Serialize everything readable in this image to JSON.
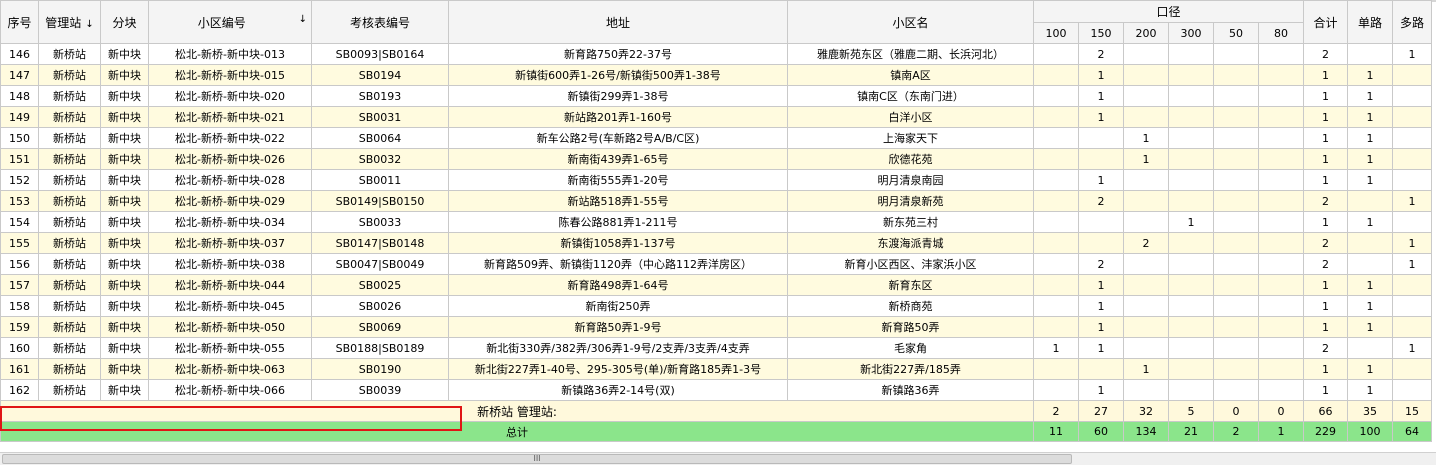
{
  "columns": {
    "seq": "序号",
    "station": "管理站",
    "block": "分块",
    "community_code": "小区编号",
    "meter_code": "考核表编号",
    "address": "地址",
    "community_name": "小区名",
    "diameter": "口径",
    "d100": "100",
    "d150": "150",
    "d200": "200",
    "d300": "300",
    "d50": "50",
    "d80": "80",
    "total": "合计",
    "single": "单路",
    "multi": "多路",
    "sort_desc": "↓"
  },
  "rows": [
    {
      "seq": "146",
      "station": "新桥站",
      "block": "新中块",
      "community_code": "松北-新桥-新中块-013",
      "meter_code": "SB0093|SB0164",
      "address": "新育路750弄22-37号",
      "community_name": "雅鹿新苑东区（雅鹿二期、长浜河北）",
      "d100": "",
      "d150": "2",
      "d200": "",
      "d300": "",
      "d50": "",
      "d80": "",
      "total": "2",
      "single": "",
      "multi": "1"
    },
    {
      "seq": "147",
      "station": "新桥站",
      "block": "新中块",
      "community_code": "松北-新桥-新中块-015",
      "meter_code": "SB0194",
      "address": "新镇街600弄1-26号/新镇街500弄1-38号",
      "community_name": "镇南A区",
      "d100": "",
      "d150": "1",
      "d200": "",
      "d300": "",
      "d50": "",
      "d80": "",
      "total": "1",
      "single": "1",
      "multi": ""
    },
    {
      "seq": "148",
      "station": "新桥站",
      "block": "新中块",
      "community_code": "松北-新桥-新中块-020",
      "meter_code": "SB0193",
      "address": "新镇街299弄1-38号",
      "community_name": "镇南C区（东南门进）",
      "d100": "",
      "d150": "1",
      "d200": "",
      "d300": "",
      "d50": "",
      "d80": "",
      "total": "1",
      "single": "1",
      "multi": ""
    },
    {
      "seq": "149",
      "station": "新桥站",
      "block": "新中块",
      "community_code": "松北-新桥-新中块-021",
      "meter_code": "SB0031",
      "address": "新站路201弄1-160号",
      "community_name": "白洋小区",
      "d100": "",
      "d150": "1",
      "d200": "",
      "d300": "",
      "d50": "",
      "d80": "",
      "total": "1",
      "single": "1",
      "multi": ""
    },
    {
      "seq": "150",
      "station": "新桥站",
      "block": "新中块",
      "community_code": "松北-新桥-新中块-022",
      "meter_code": "SB0064",
      "address": "新车公路2号(车新路2号A/B/C区)",
      "community_name": "上海家天下",
      "d100": "",
      "d150": "",
      "d200": "1",
      "d300": "",
      "d50": "",
      "d80": "",
      "total": "1",
      "single": "1",
      "multi": ""
    },
    {
      "seq": "151",
      "station": "新桥站",
      "block": "新中块",
      "community_code": "松北-新桥-新中块-026",
      "meter_code": "SB0032",
      "address": "新南街439弄1-65号",
      "community_name": "欣德花苑",
      "d100": "",
      "d150": "",
      "d200": "1",
      "d300": "",
      "d50": "",
      "d80": "",
      "total": "1",
      "single": "1",
      "multi": ""
    },
    {
      "seq": "152",
      "station": "新桥站",
      "block": "新中块",
      "community_code": "松北-新桥-新中块-028",
      "meter_code": "SB0011",
      "address": "新南街555弄1-20号",
      "community_name": "明月清泉南园",
      "d100": "",
      "d150": "1",
      "d200": "",
      "d300": "",
      "d50": "",
      "d80": "",
      "total": "1",
      "single": "1",
      "multi": ""
    },
    {
      "seq": "153",
      "station": "新桥站",
      "block": "新中块",
      "community_code": "松北-新桥-新中块-029",
      "meter_code": "SB0149|SB0150",
      "address": "新站路518弄1-55号",
      "community_name": "明月清泉新苑",
      "d100": "",
      "d150": "2",
      "d200": "",
      "d300": "",
      "d50": "",
      "d80": "",
      "total": "2",
      "single": "",
      "multi": "1"
    },
    {
      "seq": "154",
      "station": "新桥站",
      "block": "新中块",
      "community_code": "松北-新桥-新中块-034",
      "meter_code": "SB0033",
      "address": "陈春公路881弄1-211号",
      "community_name": "新东苑三村",
      "d100": "",
      "d150": "",
      "d200": "",
      "d300": "1",
      "d50": "",
      "d80": "",
      "total": "1",
      "single": "1",
      "multi": ""
    },
    {
      "seq": "155",
      "station": "新桥站",
      "block": "新中块",
      "community_code": "松北-新桥-新中块-037",
      "meter_code": "SB0147|SB0148",
      "address": "新镇街1058弄1-137号",
      "community_name": "东渡海派青城",
      "d100": "",
      "d150": "",
      "d200": "2",
      "d300": "",
      "d50": "",
      "d80": "",
      "total": "2",
      "single": "",
      "multi": "1"
    },
    {
      "seq": "156",
      "station": "新桥站",
      "block": "新中块",
      "community_code": "松北-新桥-新中块-038",
      "meter_code": "SB0047|SB0049",
      "address": "新育路509弄、新镇街1120弄（中心路112弄洋房区）",
      "community_name": "新育小区西区、沣家浜小区",
      "d100": "",
      "d150": "2",
      "d200": "",
      "d300": "",
      "d50": "",
      "d80": "",
      "total": "2",
      "single": "",
      "multi": "1"
    },
    {
      "seq": "157",
      "station": "新桥站",
      "block": "新中块",
      "community_code": "松北-新桥-新中块-044",
      "meter_code": "SB0025",
      "address": "新育路498弄1-64号",
      "community_name": "新育东区",
      "d100": "",
      "d150": "1",
      "d200": "",
      "d300": "",
      "d50": "",
      "d80": "",
      "total": "1",
      "single": "1",
      "multi": ""
    },
    {
      "seq": "158",
      "station": "新桥站",
      "block": "新中块",
      "community_code": "松北-新桥-新中块-045",
      "meter_code": "SB0026",
      "address": "新南街250弄",
      "community_name": "新桥商苑",
      "d100": "",
      "d150": "1",
      "d200": "",
      "d300": "",
      "d50": "",
      "d80": "",
      "total": "1",
      "single": "1",
      "multi": ""
    },
    {
      "seq": "159",
      "station": "新桥站",
      "block": "新中块",
      "community_code": "松北-新桥-新中块-050",
      "meter_code": "SB0069",
      "address": "新育路50弄1-9号",
      "community_name": "新育路50弄",
      "d100": "",
      "d150": "1",
      "d200": "",
      "d300": "",
      "d50": "",
      "d80": "",
      "total": "1",
      "single": "1",
      "multi": ""
    },
    {
      "seq": "160",
      "station": "新桥站",
      "block": "新中块",
      "community_code": "松北-新桥-新中块-055",
      "meter_code": "SB0188|SB0189",
      "address": "新北街330弄/382弄/306弄1-9号/2支弄/3支弄/4支弄",
      "community_name": "毛家角",
      "d100": "1",
      "d150": "1",
      "d200": "",
      "d300": "",
      "d50": "",
      "d80": "",
      "total": "2",
      "single": "",
      "multi": "1"
    },
    {
      "seq": "161",
      "station": "新桥站",
      "block": "新中块",
      "community_code": "松北-新桥-新中块-063",
      "meter_code": "SB0190",
      "address": "新北街227弄1-40号、295-305号(单)/新育路185弄1-3号",
      "community_name": "新北街227弄/185弄",
      "d100": "",
      "d150": "",
      "d200": "1",
      "d300": "",
      "d50": "",
      "d80": "",
      "total": "1",
      "single": "1",
      "multi": ""
    },
    {
      "seq": "162",
      "station": "新桥站",
      "block": "新中块",
      "community_code": "松北-新桥-新中块-066",
      "meter_code": "SB0039",
      "address": "新镇路36弄2-14号(双)",
      "community_name": "新镇路36弄",
      "d100": "",
      "d150": "1",
      "d200": "",
      "d300": "",
      "d50": "",
      "d80": "",
      "total": "1",
      "single": "1",
      "multi": ""
    }
  ],
  "subtotal": {
    "label": "新桥站  管理站:",
    "d100": "2",
    "d150": "27",
    "d200": "32",
    "d300": "5",
    "d50": "0",
    "d80": "0",
    "total": "66",
    "single": "35",
    "multi": "15"
  },
  "grand_total": {
    "label": "总计",
    "d100": "11",
    "d150": "60",
    "d200": "134",
    "d300": "21",
    "d50": "2",
    "d80": "1",
    "total": "229",
    "single": "100",
    "multi": "64"
  },
  "scrollbar": {
    "grip": "III"
  },
  "colors": {
    "odd_row": "#ffffff",
    "even_row": "#fffbdf",
    "subtotal_row": "#fff9dc",
    "total_row": "#8be58b",
    "highlight_border": "#e01515"
  }
}
